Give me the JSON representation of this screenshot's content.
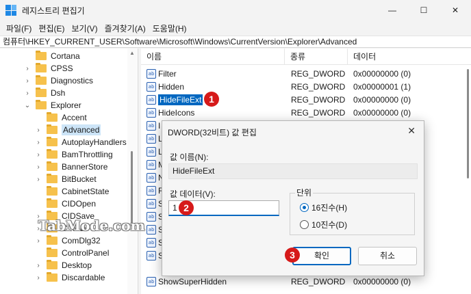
{
  "window": {
    "title": "레지스트리 편집기",
    "minimize": "—",
    "maximize": "☐",
    "close": "✕"
  },
  "menu": [
    "파일(F)",
    "편집(E)",
    "보기(V)",
    "즐겨찾기(A)",
    "도움말(H)"
  ],
  "address": "컴퓨터\\HKEY_CURRENT_USER\\Software\\Microsoft\\Windows\\CurrentVersion\\Explorer\\Advanced",
  "tree": {
    "items": [
      {
        "label": "Cortana",
        "expanded": false
      },
      {
        "label": "CPSS",
        "expanded": false
      },
      {
        "label": "Diagnostics",
        "expanded": false
      },
      {
        "label": "Dsh",
        "expanded": false
      },
      {
        "label": "Explorer",
        "expanded": true
      },
      {
        "label": "Accent",
        "expanded": false
      },
      {
        "label": "Advanced",
        "expanded": false,
        "selected": true
      },
      {
        "label": "AutoplayHandlers",
        "expanded": false
      },
      {
        "label": "BamThrottling",
        "expanded": false
      },
      {
        "label": "BannerStore",
        "expanded": false
      },
      {
        "label": "BitBucket",
        "expanded": false
      },
      {
        "label": "CabinetState",
        "expanded": false
      },
      {
        "label": "CIDOpen",
        "expanded": false
      },
      {
        "label": "CIDSave",
        "expanded": false
      },
      {
        "label": "CLSID",
        "expanded": false
      },
      {
        "label": "ComDlg32",
        "expanded": false
      },
      {
        "label": "ControlPanel",
        "expanded": false
      },
      {
        "label": "Desktop",
        "expanded": false
      },
      {
        "label": "Discardable",
        "expanded": false
      }
    ]
  },
  "list": {
    "columns": {
      "name": "이름",
      "type": "종류",
      "data": "데이터"
    },
    "rows": [
      {
        "name": "Filter",
        "type": "REG_DWORD",
        "data": "0x00000000 (0)"
      },
      {
        "name": "Hidden",
        "type": "REG_DWORD",
        "data": "0x00000001 (1)"
      },
      {
        "name": "HideFileExt",
        "type": "REG_DWORD",
        "data": "0x00000000 (0)",
        "highlighted": true
      },
      {
        "name": "HideIcons",
        "type": "REG_DWORD",
        "data": "0x00000000 (0)"
      },
      {
        "name": "ShowSuperHidden",
        "type": "REG_DWORD",
        "data": "0x00000000 (0)"
      }
    ],
    "icon": "ab",
    "partial_first_letters": [
      "I",
      "L",
      "L",
      "M",
      "N",
      "R",
      "S",
      "S",
      "S",
      "S",
      "S"
    ]
  },
  "dialog": {
    "title": "DWORD(32비트) 값 편집",
    "close": "✕",
    "name_label": "값 이름(N):",
    "name_value": "HideFileExt",
    "data_label": "값 데이터(V):",
    "data_value": "1",
    "radix_label": "단위",
    "radix_hex": "16진수(H)",
    "radix_dec": "10진수(D)",
    "ok_label": "확인",
    "cancel_label": "취소"
  },
  "badges": [
    "1",
    "2",
    "3"
  ],
  "watermark": "TabMode.com"
}
